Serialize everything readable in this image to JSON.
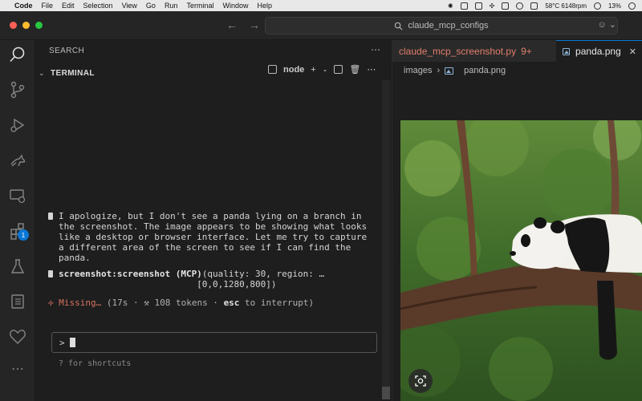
{
  "menubar": {
    "app": "Code",
    "items": [
      "File",
      "Edit",
      "Selection",
      "View",
      "Go",
      "Run",
      "Terminal",
      "Window",
      "Help"
    ],
    "temperature": "58°C 6148rpm",
    "battery": "13%"
  },
  "titlebar": {
    "search_text": "claude_mcp_configs"
  },
  "sidebar": {
    "search_header": "SEARCH",
    "terminal_header": "TERMINAL",
    "terminal_profile": "node",
    "extensions_badge": "1"
  },
  "terminal": {
    "message_lines": [
      "I apologize, but I don't see a panda lying on a branch in",
      "the screenshot. The image appears to be showing what looks",
      "like a desktop or browser interface. Let me try to capture",
      "a different area of the screen to see if I can find the",
      "panda."
    ],
    "tool_name": "screenshot:screenshot (MCP)",
    "tool_args_line1": "(quality: 30, region: …",
    "tool_args_line2": "[0,0,1280,800])",
    "status_star": "✢",
    "status_word": "Missing…",
    "status_detail": "(17s · ⚒ 108 tokens · ",
    "status_key": "esc",
    "status_tail": " to interrupt)",
    "prompt_symbol": ">",
    "hint": "? for shortcuts"
  },
  "editor": {
    "tab1_label": "claude_mcp_screenshot.py",
    "tab1_count": "9+",
    "tab2_label": "panda.png",
    "breadcrumb_folder": "images",
    "breadcrumb_file": "panda.png"
  }
}
